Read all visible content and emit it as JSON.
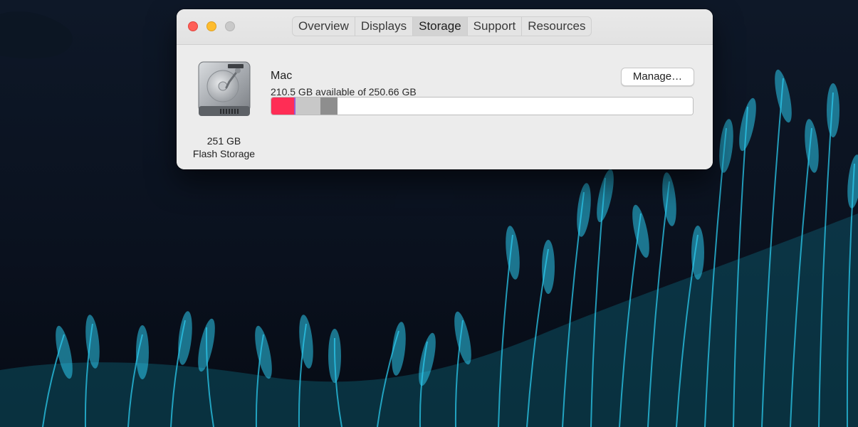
{
  "window": {
    "tabs": [
      {
        "label": "Overview",
        "active": false
      },
      {
        "label": "Displays",
        "active": false
      },
      {
        "label": "Storage",
        "active": true
      },
      {
        "label": "Support",
        "active": false
      },
      {
        "label": "Resources",
        "active": false
      }
    ]
  },
  "storage": {
    "drive_icon": "hard-drive-icon",
    "drive_size": "251 GB",
    "drive_type": "Flash Storage",
    "disk_name": "Mac",
    "available_text": "210.5 GB available of 250.66 GB",
    "manage_label": "Manage…",
    "usage_segments": [
      {
        "name": "apps",
        "fraction": 0.054,
        "color": "#ff2d55"
      },
      {
        "name": "other-purple",
        "fraction": 0.003,
        "color": "#9b59d0"
      },
      {
        "name": "other-light",
        "fraction": 0.06,
        "color": "#c8c8c8"
      },
      {
        "name": "system",
        "fraction": 0.04,
        "color": "#8e8e8e"
      },
      {
        "name": "available",
        "fraction": 0.843,
        "color": "#ffffff"
      }
    ]
  },
  "colors": {
    "accent_red": "#ff5f57",
    "accent_yellow": "#febc2e",
    "grass": "#2bc9ec"
  }
}
